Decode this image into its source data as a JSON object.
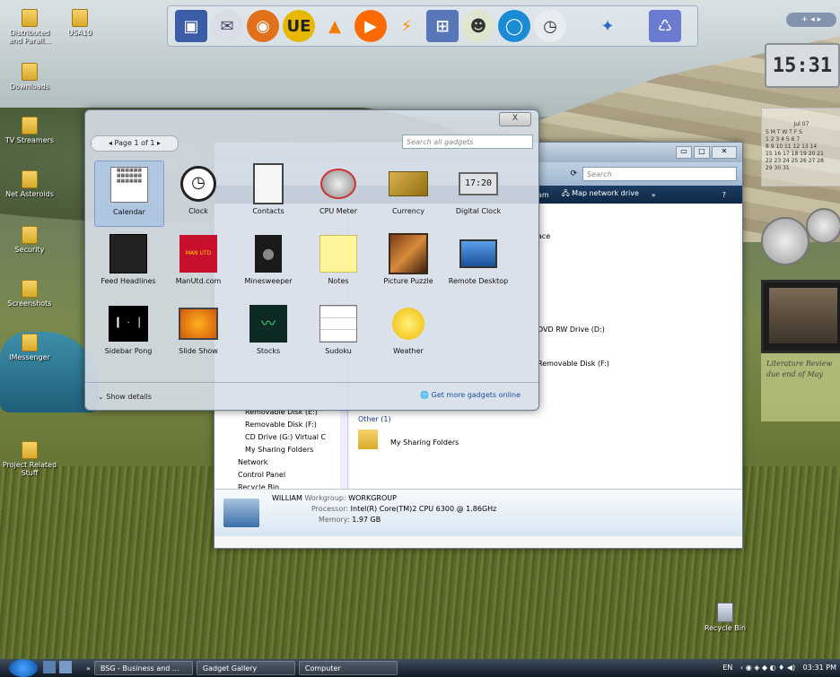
{
  "desktop": {
    "icons": [
      {
        "label": "Distributed and Parall...",
        "name": "desktop-icon-distributed"
      },
      {
        "label": "USA10",
        "name": "desktop-icon-usa10"
      },
      {
        "label": "Downloads",
        "name": "desktop-icon-downloads"
      },
      {
        "label": "TV Streamers",
        "name": "desktop-icon-tv-streamers"
      },
      {
        "label": "Net Asteroids",
        "name": "desktop-icon-net-asteroids"
      },
      {
        "label": "Security",
        "name": "desktop-icon-security"
      },
      {
        "label": "Screenshots",
        "name": "desktop-icon-screenshots"
      },
      {
        "label": "IMessenger",
        "name": "desktop-icon-imessenger"
      },
      {
        "label": "Project Related Stuff",
        "name": "desktop-icon-project"
      }
    ],
    "recycle_bin": "Recycle Bin"
  },
  "sidebar": {
    "clock_time": "15:31",
    "calendar_month": "Jul 07",
    "note_text": "Literature Review due end of May"
  },
  "gallery": {
    "close_label": "X",
    "pager": "Page 1 of 1",
    "search_placeholder": "Search all gadgets",
    "show_details": "Show details",
    "get_more": "Get more gadgets online",
    "gadgets": [
      {
        "label": "Calendar",
        "icon": "calendar-icon",
        "selected": true
      },
      {
        "label": "Clock",
        "icon": "clock-icon"
      },
      {
        "label": "Contacts",
        "icon": "contacts-icon"
      },
      {
        "label": "CPU Meter",
        "icon": "cpu-meter-icon"
      },
      {
        "label": "Currency",
        "icon": "currency-icon"
      },
      {
        "label": "Digital Clock",
        "icon": "digital-clock-icon",
        "display": "17:20"
      },
      {
        "label": "Feed Headlines",
        "icon": "feed-icon"
      },
      {
        "label": "ManUtd.com",
        "icon": "manutd-icon"
      },
      {
        "label": "Minesweeper",
        "icon": "minesweeper-icon"
      },
      {
        "label": "Notes",
        "icon": "notes-icon"
      },
      {
        "label": "Picture Puzzle",
        "icon": "puzzle-icon"
      },
      {
        "label": "Remote Desktop",
        "icon": "remote-desktop-icon"
      },
      {
        "label": "Sidebar Pong",
        "icon": "pong-icon"
      },
      {
        "label": "Slide Show",
        "icon": "slideshow-icon"
      },
      {
        "label": "Stocks",
        "icon": "stocks-icon"
      },
      {
        "label": "Sudoku",
        "icon": "sudoku-icon"
      },
      {
        "label": "Weather",
        "icon": "weather-icon"
      }
    ]
  },
  "explorer": {
    "search_placeholder": "Search",
    "toolbar": {
      "program": "am",
      "map_drive": "Map network drive",
      "more": "»"
    },
    "column_header": "ace",
    "nav_items": [
      "Removable Disk (E:)",
      "Removable Disk (F:)",
      "CD Drive (G:) Virtual C",
      "My Sharing Folders",
      "Network",
      "Control Panel",
      "Recycle Bin"
    ],
    "drives": [
      {
        "label": "DVD RW Drive (D:)"
      },
      {
        "label": "Removable Disk (F:)"
      }
    ],
    "other_group": "Other (1)",
    "sharing": "My Sharing Folders",
    "details": {
      "computer": "WILLIAM",
      "workgroup_label": "Workgroup:",
      "workgroup": "WORKGROUP",
      "processor_label": "Processor:",
      "processor": "Intel(R) Core(TM)2 CPU      6300  @ 1.86GHz",
      "memory_label": "Memory:",
      "memory": "1.97 GB"
    }
  },
  "taskbar": {
    "buttons": [
      {
        "label": "BSG - Business and ..."
      },
      {
        "label": "Gadget Gallery"
      },
      {
        "label": "Computer"
      }
    ],
    "lang": "EN",
    "time": "03:31 PM"
  }
}
